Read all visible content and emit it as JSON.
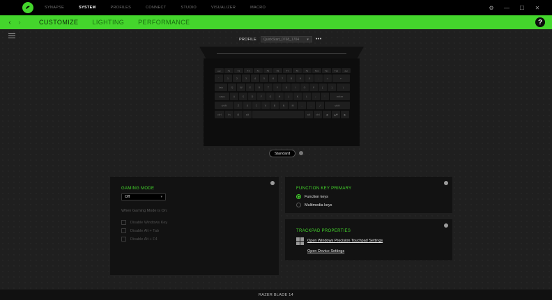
{
  "app": {
    "top_nav": [
      {
        "label": "SYNAPSE",
        "active": false
      },
      {
        "label": "SYSTEM",
        "active": true
      },
      {
        "label": "PROFILES",
        "active": false
      },
      {
        "label": "CONNECT",
        "active": false
      },
      {
        "label": "STUDIO",
        "active": false
      },
      {
        "label": "VISUALIZER",
        "active": false
      },
      {
        "label": "MACRO",
        "active": false
      }
    ],
    "window_controls": {
      "settings": "⚙",
      "minimize": "—",
      "maximize": "☐",
      "close": "✕"
    },
    "accent_color": "#44d62c"
  },
  "subnav": {
    "back": "‹",
    "forward": "›",
    "tabs": [
      {
        "label": "CUSTOMIZE",
        "active": true
      },
      {
        "label": "LIGHTING",
        "active": false
      },
      {
        "label": "PERFORMANCE",
        "active": false
      }
    ],
    "help": "?"
  },
  "profile": {
    "label": "PROFILE",
    "value": "QuickStart_0768_1704",
    "more": "•••"
  },
  "keyboard": {
    "rows": [
      [
        "esc",
        "F1",
        "F2",
        "F3",
        "F4",
        "F5",
        "F6",
        "F7",
        "F8",
        "F9",
        "F10",
        "F11",
        "F12",
        "del"
      ],
      [
        "`",
        "1",
        "2",
        "3",
        "4",
        "5",
        "6",
        "7",
        "8",
        "9",
        "0",
        "-",
        "=",
        "←"
      ],
      [
        "tab",
        "Q",
        "W",
        "E",
        "R",
        "T",
        "Y",
        "U",
        "I",
        "O",
        "P",
        "[",
        "]",
        "\\"
      ],
      [
        "caps",
        "A",
        "S",
        "D",
        "F",
        "G",
        "H",
        "J",
        "K",
        "L",
        ";",
        "'",
        "enter"
      ],
      [
        "shift",
        "Z",
        "X",
        "C",
        "V",
        "B",
        "N",
        "M",
        ",",
        ".",
        "/",
        "shift"
      ],
      [
        "ctrl",
        "fn",
        "⊞",
        "alt",
        "",
        "alt",
        "ctrl",
        "◀",
        "▲▼",
        "▶"
      ]
    ]
  },
  "standard": {
    "label": "Standard"
  },
  "gaming_mode": {
    "title": "GAMING MODE",
    "select_value": "Off",
    "when_label": "When Gaming Mode is On:",
    "options": [
      {
        "label": "Disable Windows Key"
      },
      {
        "label": "Disable Alt + Tab"
      },
      {
        "label": "Disable Alt + F4"
      }
    ]
  },
  "function_key": {
    "title": "FUNCTION KEY PRIMARY",
    "options": [
      {
        "label": "Function keys",
        "checked": true
      },
      {
        "label": "Multimedia keys",
        "checked": false
      }
    ]
  },
  "trackpad": {
    "title": "TRACKPAD PROPERTIES",
    "link_primary": "Open Windows Precision Touchpad Settings",
    "link_device": "Open Device Settings"
  },
  "footer": {
    "device_name": "RAZER BLADE 14"
  }
}
